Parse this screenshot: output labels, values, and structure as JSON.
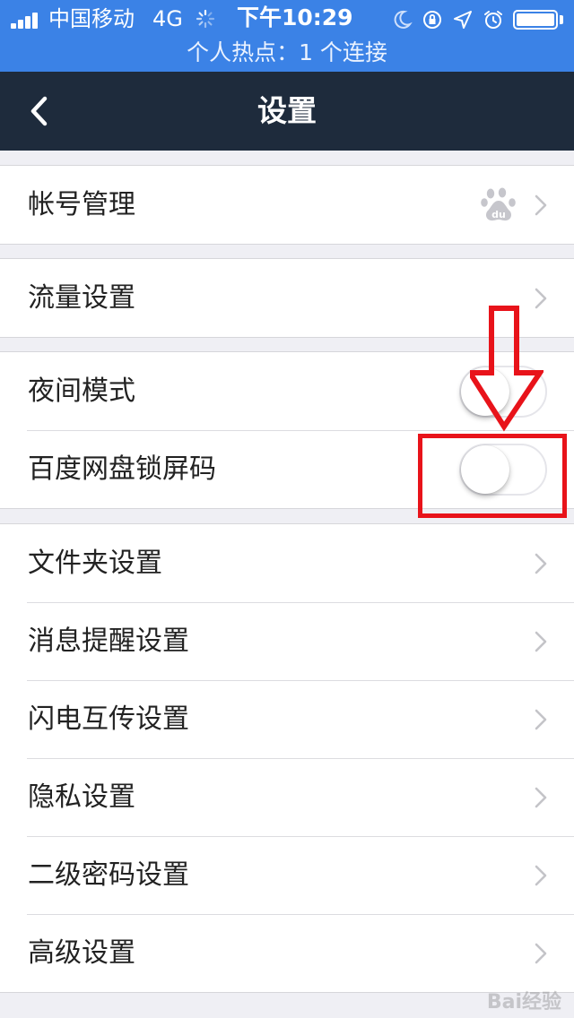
{
  "status_bar": {
    "carrier": "中国移动",
    "network": "4G",
    "time": "下午10:29",
    "hotspot_text": "个人热点：1 个连接",
    "icons": [
      "signal-icon",
      "loading-spinner-icon",
      "moon-icon",
      "rotation-lock-icon",
      "location-icon",
      "alarm-icon",
      "battery-icon"
    ]
  },
  "nav": {
    "title": "设置",
    "back_icon": "chevron-left-icon"
  },
  "settings": {
    "account": {
      "label": "帐号管理",
      "icon": "baidu-logo-icon"
    },
    "traffic": {
      "label": "流量设置"
    },
    "night_mode": {
      "label": "夜间模式",
      "toggle_on": false
    },
    "lock_screen": {
      "label": "百度网盘锁屏码",
      "toggle_on": false
    },
    "folder": {
      "label": "文件夹设置"
    },
    "notification": {
      "label": "消息提醒设置"
    },
    "flash_transfer": {
      "label": "闪电互传设置"
    },
    "privacy": {
      "label": "隐私设置"
    },
    "second_password": {
      "label": "二级密码设置"
    },
    "advanced": {
      "label": "高级设置"
    }
  },
  "watermark": "Bai经验",
  "colors": {
    "status_bar_bg": "#3b82e6",
    "nav_bg": "#1e2b3c",
    "annotation_red": "#e8131a",
    "page_bg": "#efeff4"
  }
}
